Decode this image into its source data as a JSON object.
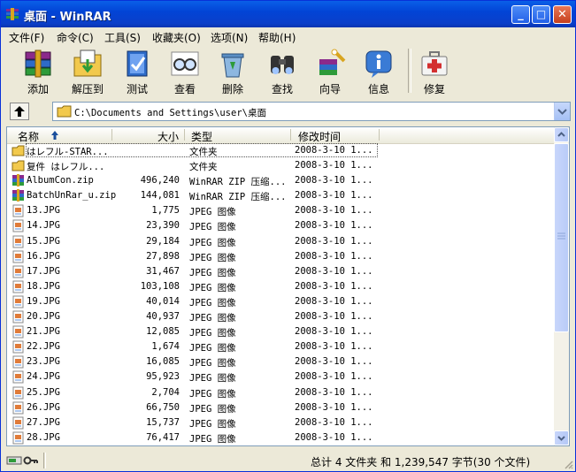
{
  "window": {
    "title": "桌面 - WinRAR",
    "controls": {
      "minimize": "_",
      "maximize": "□",
      "close": "✕"
    }
  },
  "menu": [
    {
      "label": "文件(F)"
    },
    {
      "label": "命令(C)"
    },
    {
      "label": "工具(S)"
    },
    {
      "label": "收藏夹(O)"
    },
    {
      "label": "选项(N)"
    },
    {
      "label": "帮助(H)"
    }
  ],
  "toolbar": [
    {
      "label": "添加",
      "icon": "add-books-icon"
    },
    {
      "label": "解压到",
      "icon": "extract-folder-icon"
    },
    {
      "label": "测试",
      "icon": "test-book-icon"
    },
    {
      "label": "查看",
      "icon": "view-glasses-icon"
    },
    {
      "label": "删除",
      "icon": "delete-recycle-icon"
    },
    {
      "label": "查找",
      "icon": "find-binoculars-icon"
    },
    {
      "label": "向导",
      "icon": "wizard-icon"
    },
    {
      "label": "信息",
      "icon": "info-icon"
    },
    {
      "label": "修复",
      "icon": "repair-kit-icon"
    }
  ],
  "address": {
    "path": "C:\\Documents and Settings\\user\\桌面"
  },
  "columns": {
    "name": "名称",
    "size": "大小",
    "type": "类型",
    "modified": "修改时间"
  },
  "files": [
    {
      "name": "はレフル-STAR...",
      "size": "",
      "type": "文件夹",
      "modified": "2008-3-10 1...",
      "kind": "folder"
    },
    {
      "name": "复件 はレフル...",
      "size": "",
      "type": "文件夹",
      "modified": "2008-3-10 1...",
      "kind": "folder"
    },
    {
      "name": "AlbumCon.zip",
      "size": "496,240",
      "type": "WinRAR ZIP 压缩...",
      "modified": "2008-3-10 1...",
      "kind": "zip"
    },
    {
      "name": "BatchUnRar_u.zip",
      "size": "144,081",
      "type": "WinRAR ZIP 压缩...",
      "modified": "2008-3-10 1...",
      "kind": "zip"
    },
    {
      "name": "13.JPG",
      "size": "1,775",
      "type": "JPEG 图像",
      "modified": "2008-3-10 1...",
      "kind": "jpg"
    },
    {
      "name": "14.JPG",
      "size": "23,390",
      "type": "JPEG 图像",
      "modified": "2008-3-10 1...",
      "kind": "jpg"
    },
    {
      "name": "15.JPG",
      "size": "29,184",
      "type": "JPEG 图像",
      "modified": "2008-3-10 1...",
      "kind": "jpg"
    },
    {
      "name": "16.JPG",
      "size": "27,898",
      "type": "JPEG 图像",
      "modified": "2008-3-10 1...",
      "kind": "jpg"
    },
    {
      "name": "17.JPG",
      "size": "31,467",
      "type": "JPEG 图像",
      "modified": "2008-3-10 1...",
      "kind": "jpg"
    },
    {
      "name": "18.JPG",
      "size": "103,108",
      "type": "JPEG 图像",
      "modified": "2008-3-10 1...",
      "kind": "jpg"
    },
    {
      "name": "19.JPG",
      "size": "40,014",
      "type": "JPEG 图像",
      "modified": "2008-3-10 1...",
      "kind": "jpg"
    },
    {
      "name": "20.JPG",
      "size": "40,937",
      "type": "JPEG 图像",
      "modified": "2008-3-10 1...",
      "kind": "jpg"
    },
    {
      "name": "21.JPG",
      "size": "12,085",
      "type": "JPEG 图像",
      "modified": "2008-3-10 1...",
      "kind": "jpg"
    },
    {
      "name": "22.JPG",
      "size": "1,674",
      "type": "JPEG 图像",
      "modified": "2008-3-10 1...",
      "kind": "jpg"
    },
    {
      "name": "23.JPG",
      "size": "16,085",
      "type": "JPEG 图像",
      "modified": "2008-3-10 1...",
      "kind": "jpg"
    },
    {
      "name": "24.JPG",
      "size": "95,923",
      "type": "JPEG 图像",
      "modified": "2008-3-10 1...",
      "kind": "jpg"
    },
    {
      "name": "25.JPG",
      "size": "2,704",
      "type": "JPEG 图像",
      "modified": "2008-3-10 1...",
      "kind": "jpg"
    },
    {
      "name": "26.JPG",
      "size": "66,750",
      "type": "JPEG 图像",
      "modified": "2008-3-10 1...",
      "kind": "jpg"
    },
    {
      "name": "27.JPG",
      "size": "15,737",
      "type": "JPEG 图像",
      "modified": "2008-3-10 1...",
      "kind": "jpg"
    },
    {
      "name": "28.JPG",
      "size": "76,417",
      "type": "JPEG 图像",
      "modified": "2008-3-10 1...",
      "kind": "jpg"
    }
  ],
  "status": {
    "summary": "总计 4 文件夹 和 1,239,547 字节(30 个文件)"
  }
}
